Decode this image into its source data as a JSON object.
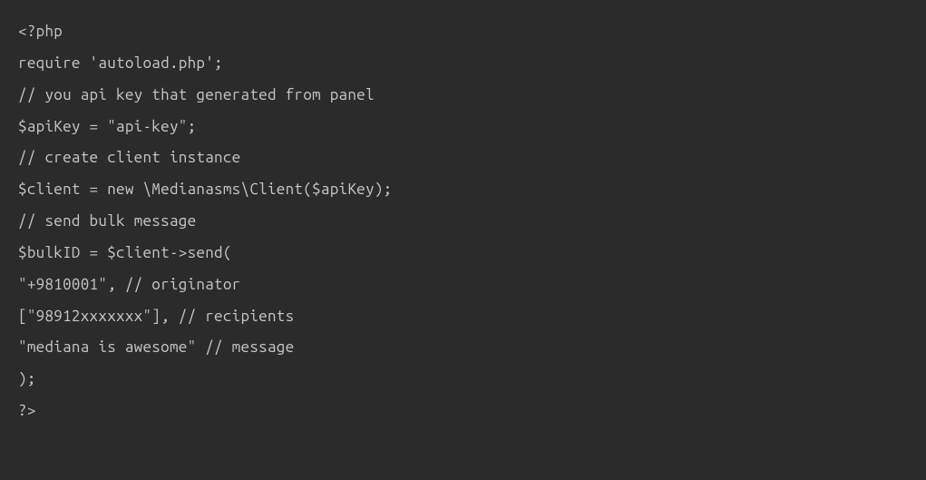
{
  "code": {
    "lines": [
      "<?php",
      "require 'autoload.php';",
      "// you api key that generated from panel",
      "$apiKey = \"api-key\";",
      "// create client instance",
      "$client = new \\Medianasms\\Client($apiKey);",
      "// send bulk message",
      "$bulkID = $client->send(",
      "\"+9810001\", // originator",
      "[\"98912xxxxxxx\"], // recipients",
      "\"mediana is awesome\" // message",
      ");",
      "?>"
    ]
  }
}
